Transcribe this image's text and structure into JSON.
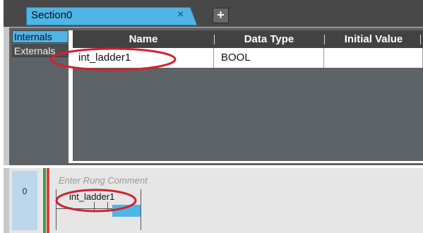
{
  "editor": {
    "tab_title": "Section0",
    "tab_close": "×",
    "add_tab": "+"
  },
  "variable_table": {
    "side_tabs": [
      "Internals",
      "Externals"
    ],
    "columns": [
      "Name",
      "Data Type",
      "Initial Value"
    ],
    "rows": [
      {
        "name": "int_ladder1",
        "data_type": "BOOL",
        "initial_value": ""
      }
    ]
  },
  "ladder": {
    "rung_number": "0",
    "rung_comment_placeholder": "Enter Rung Comment",
    "contact_variable": "int_ladder1"
  },
  "colors": {
    "selection_blue": "#4fb4e6",
    "annotation_red": "#d42030",
    "rail_green": "#3a9e48",
    "rail_red": "#d8403a"
  }
}
